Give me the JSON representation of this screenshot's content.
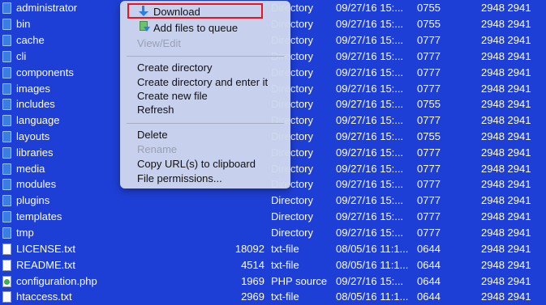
{
  "colors": {
    "list_background": "#1e3fd6",
    "menu_background": "#ced6ec",
    "highlight_border": "#e8141e"
  },
  "files": [
    {
      "name": "administrator",
      "size": "",
      "type": "Directory",
      "date": "09/27/16 15:...",
      "perms": "0755",
      "owner": "2948 2941",
      "icon": "folder-icon"
    },
    {
      "name": "bin",
      "size": "",
      "type": "Directory",
      "date": "09/27/16 15:...",
      "perms": "0755",
      "owner": "2948 2941",
      "icon": "folder-icon"
    },
    {
      "name": "cache",
      "size": "",
      "type": "Directory",
      "date": "09/27/16 15:...",
      "perms": "0777",
      "owner": "2948 2941",
      "icon": "folder-icon"
    },
    {
      "name": "cli",
      "size": "",
      "type": "Directory",
      "date": "09/27/16 15:...",
      "perms": "0777",
      "owner": "2948 2941",
      "icon": "folder-icon"
    },
    {
      "name": "components",
      "size": "",
      "type": "Directory",
      "date": "09/27/16 15:...",
      "perms": "0777",
      "owner": "2948 2941",
      "icon": "folder-icon"
    },
    {
      "name": "images",
      "size": "",
      "type": "Directory",
      "date": "09/27/16 15:...",
      "perms": "0777",
      "owner": "2948 2941",
      "icon": "folder-icon"
    },
    {
      "name": "includes",
      "size": "",
      "type": "Directory",
      "date": "09/27/16 15:...",
      "perms": "0755",
      "owner": "2948 2941",
      "icon": "folder-icon"
    },
    {
      "name": "language",
      "size": "",
      "type": "Directory",
      "date": "09/27/16 15:...",
      "perms": "0777",
      "owner": "2948 2941",
      "icon": "folder-icon"
    },
    {
      "name": "layouts",
      "size": "",
      "type": "Directory",
      "date": "09/27/16 15:...",
      "perms": "0755",
      "owner": "2948 2941",
      "icon": "folder-icon"
    },
    {
      "name": "libraries",
      "size": "",
      "type": "Directory",
      "date": "09/27/16 15:...",
      "perms": "0777",
      "owner": "2948 2941",
      "icon": "folder-icon"
    },
    {
      "name": "media",
      "size": "",
      "type": "Directory",
      "date": "09/27/16 15:...",
      "perms": "0777",
      "owner": "2948 2941",
      "icon": "folder-icon"
    },
    {
      "name": "modules",
      "size": "",
      "type": "Directory",
      "date": "09/27/16 15:...",
      "perms": "0777",
      "owner": "2948 2941",
      "icon": "folder-icon"
    },
    {
      "name": "plugins",
      "size": "",
      "type": "Directory",
      "date": "09/27/16 15:...",
      "perms": "0777",
      "owner": "2948 2941",
      "icon": "folder-icon"
    },
    {
      "name": "templates",
      "size": "",
      "type": "Directory",
      "date": "09/27/16 15:...",
      "perms": "0777",
      "owner": "2948 2941",
      "icon": "folder-icon"
    },
    {
      "name": "tmp",
      "size": "",
      "type": "Directory",
      "date": "09/27/16 15:...",
      "perms": "0777",
      "owner": "2948 2941",
      "icon": "folder-icon"
    },
    {
      "name": "LICENSE.txt",
      "size": "18092",
      "type": "txt-file",
      "date": "08/05/16 11:1...",
      "perms": "0644",
      "owner": "2948 2941",
      "icon": "file-icon"
    },
    {
      "name": "README.txt",
      "size": "4514",
      "type": "txt-file",
      "date": "08/05/16 11:1...",
      "perms": "0644",
      "owner": "2948 2941",
      "icon": "file-icon"
    },
    {
      "name": "configuration.php",
      "size": "1969",
      "type": "PHP source",
      "date": "09/27/16 15:...",
      "perms": "0644",
      "owner": "2948 2941",
      "icon": "php-file-icon"
    },
    {
      "name": "htaccess.txt",
      "size": "2969",
      "type": "txt-file",
      "date": "08/05/16 11:1...",
      "perms": "0644",
      "owner": "2948 2941",
      "icon": "file-icon"
    }
  ],
  "context_menu": {
    "download": "Download",
    "add_to_queue": "Add files to queue",
    "view_edit": "View/Edit",
    "create_directory": "Create directory",
    "create_directory_enter": "Create directory and enter it",
    "create_new_file": "Create new file",
    "refresh": "Refresh",
    "delete": "Delete",
    "rename": "Rename",
    "copy_url": "Copy URL(s) to clipboard",
    "file_permissions": "File permissions..."
  }
}
